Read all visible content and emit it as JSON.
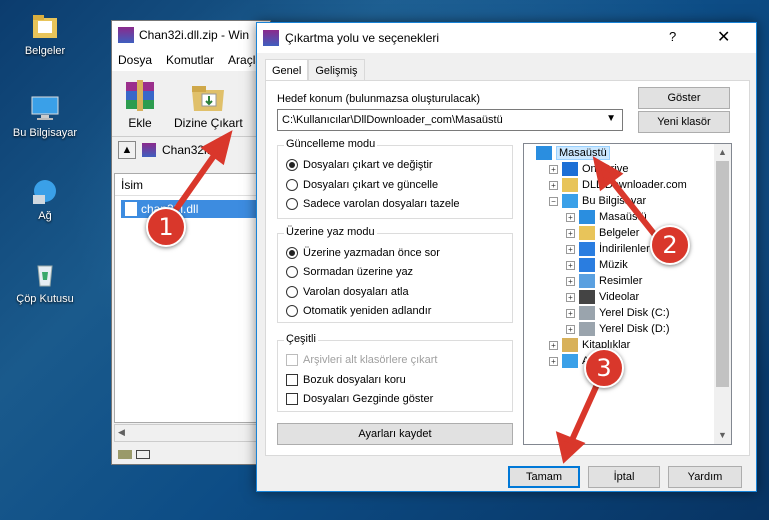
{
  "desktop": {
    "icons": [
      {
        "label": "Belgeler",
        "icon": "documents-folder-icon"
      },
      {
        "label": "Bu Bilgisayar",
        "icon": "computer-icon"
      },
      {
        "label": "Ağ",
        "icon": "network-icon"
      },
      {
        "label": "Çöp Kutusu",
        "icon": "recycle-bin-icon"
      }
    ]
  },
  "winrar": {
    "title": "Chan32i.dll.zip - Win",
    "menu": [
      "Dosya",
      "Komutlar",
      "Araçla"
    ],
    "tools": [
      {
        "label": "Ekle",
        "icon": "winrar-add-icon"
      },
      {
        "label": "Dizine Çıkart",
        "icon": "extract-to-icon"
      }
    ],
    "address": "Chan32i.dll",
    "column": "İsim",
    "file": "chan32i.dll"
  },
  "dialog": {
    "title": "Çıkartma yolu ve seçenekleri",
    "help": "?",
    "close": "✕",
    "tabs": [
      "Genel",
      "Gelişmiş"
    ],
    "dest_label": "Hedef konum (bulunmazsa oluşturulacak)",
    "dest_value": "C:\\Kullanıcılar\\DllDownloader_com\\Masaüstü",
    "show_button": "Göster",
    "new_folder_button": "Yeni klasör",
    "update_mode": {
      "title": "Güncelleme modu",
      "options": [
        {
          "label": "Dosyaları çıkart ve değiştir",
          "selected": true
        },
        {
          "label": "Dosyaları çıkart ve güncelle",
          "selected": false
        },
        {
          "label": "Sadece varolan dosyaları tazele",
          "selected": false
        }
      ]
    },
    "overwrite_mode": {
      "title": "Üzerine yaz modu",
      "options": [
        {
          "label": "Üzerine yazmadan önce sor",
          "selected": true
        },
        {
          "label": "Sormadan üzerine yaz",
          "selected": false
        },
        {
          "label": "Varolan dosyaları atla",
          "selected": false
        },
        {
          "label": "Otomatik yeniden adlandır",
          "selected": false
        }
      ]
    },
    "misc": {
      "title": "Çeşitli",
      "options": [
        {
          "label": "Arşivleri alt klasörlere çıkart",
          "checked": false,
          "disabled": true
        },
        {
          "label": "Bozuk dosyaları koru",
          "checked": false,
          "disabled": false
        },
        {
          "label": "Dosyaları Gezginde göster",
          "checked": false,
          "disabled": false
        }
      ]
    },
    "save_settings_button": "Ayarları kaydet",
    "tree": [
      {
        "label": "Masaüstü",
        "icon": "desktop-folder-icon",
        "level": 0,
        "expander": "",
        "selected": true
      },
      {
        "label": "OneDrive",
        "icon": "onedrive-icon",
        "level": 1,
        "expander": "+",
        "selected": false
      },
      {
        "label": "DLL Downloader.com",
        "icon": "user-folder-icon",
        "level": 1,
        "expander": "+",
        "selected": false
      },
      {
        "label": "Bu Bilgisayar",
        "icon": "computer-icon",
        "level": 1,
        "expander": "−",
        "selected": false
      },
      {
        "label": "Masaüstü",
        "icon": "desktop-folder-icon",
        "level": 2,
        "expander": "+",
        "selected": false
      },
      {
        "label": "Belgeler",
        "icon": "documents-folder-icon",
        "level": 2,
        "expander": "+",
        "selected": false
      },
      {
        "label": "İndirilenler",
        "icon": "downloads-folder-icon",
        "level": 2,
        "expander": "+",
        "selected": false
      },
      {
        "label": "Müzik",
        "icon": "music-folder-icon",
        "level": 2,
        "expander": "+",
        "selected": false
      },
      {
        "label": "Resimler",
        "icon": "pictures-folder-icon",
        "level": 2,
        "expander": "+",
        "selected": false
      },
      {
        "label": "Videolar",
        "icon": "videos-folder-icon",
        "level": 2,
        "expander": "+",
        "selected": false
      },
      {
        "label": "Yerel Disk (C:)",
        "icon": "drive-icon",
        "level": 2,
        "expander": "+",
        "selected": false
      },
      {
        "label": "Yerel Disk (D:)",
        "icon": "drive-icon",
        "level": 2,
        "expander": "+",
        "selected": false
      },
      {
        "label": "Kitaplıklar",
        "icon": "libraries-icon",
        "level": 1,
        "expander": "+",
        "selected": false
      },
      {
        "label": "Ağ",
        "icon": "network-icon",
        "level": 1,
        "expander": "+",
        "selected": false
      }
    ],
    "ok_button": "Tamam",
    "cancel_button": "İptal",
    "help_button": "Yardım"
  },
  "annotations": [
    "1",
    "2",
    "3"
  ],
  "colors": {
    "accent": "#0078d7",
    "annotation": "#d9372b",
    "selection": "#cce8ff"
  }
}
